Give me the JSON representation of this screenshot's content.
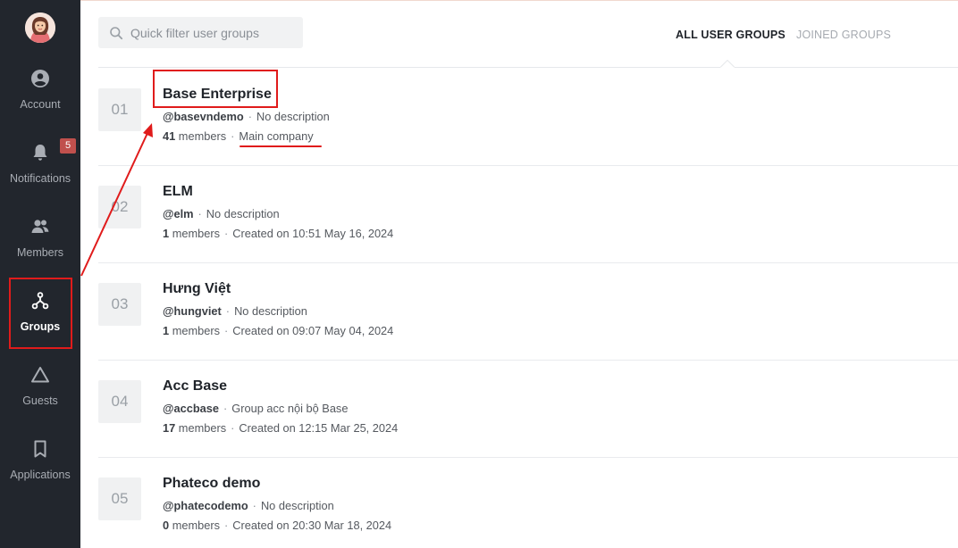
{
  "sidebar": {
    "items": [
      {
        "label": "Account",
        "icon": "account-icon"
      },
      {
        "label": "Notifications",
        "icon": "bell-icon",
        "badge": "5"
      },
      {
        "label": "Members",
        "icon": "members-icon"
      },
      {
        "label": "Groups",
        "icon": "groups-icon",
        "active": true
      },
      {
        "label": "Guests",
        "icon": "triangle-icon"
      },
      {
        "label": "Applications",
        "icon": "bookmark-icon"
      }
    ]
  },
  "search": {
    "placeholder": "Quick filter user groups"
  },
  "tabs": [
    {
      "label": "ALL USER GROUPS",
      "active": true
    },
    {
      "label": "JOINED GROUPS",
      "active": false
    }
  ],
  "groups": [
    {
      "num": "01",
      "name": "Base Enterprise",
      "handle": "@basevndemo",
      "description": "No description",
      "count": "41",
      "members_label": "members",
      "meta": "Main company"
    },
    {
      "num": "02",
      "name": "ELM",
      "handle": "@elm",
      "description": "No description",
      "count": "1",
      "members_label": "members",
      "meta": "Created on 10:51 May 16, 2024"
    },
    {
      "num": "03",
      "name": "Hưng Việt",
      "handle": "@hungviet",
      "description": "No description",
      "count": "1",
      "members_label": "members",
      "meta": "Created on 09:07 May 04, 2024"
    },
    {
      "num": "04",
      "name": "Acc Base",
      "handle": "@accbase",
      "description": "Group acc nội bộ Base",
      "count": "17",
      "members_label": "members",
      "meta": "Created on 12:15 Mar 25, 2024"
    },
    {
      "num": "05",
      "name": "Phateco demo",
      "handle": "@phatecodemo",
      "description": "No description",
      "count": "0",
      "members_label": "members",
      "meta": "Created on 20:30 Mar 18, 2024"
    }
  ],
  "colors": {
    "sidebar_bg": "#22262d",
    "annotation_red": "#e01b1b",
    "badge_red": "#c0504d"
  }
}
